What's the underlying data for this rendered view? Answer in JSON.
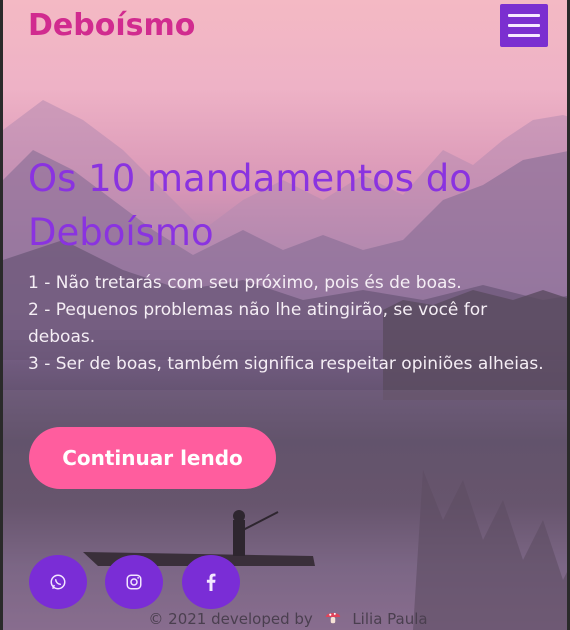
{
  "header": {
    "brand": "Deboísmo",
    "menu_icon": "hamburger-menu-icon"
  },
  "hero": {
    "title": "Os 10 mandamentos do Deboísmo",
    "commands": [
      "1 - Não tretarás com seu próximo, pois és de boas.",
      "2 - Pequenos problemas não lhe atingirão, se você for deboas.",
      "3 - Ser de boas, também significa respeitar opiniões alheias."
    ],
    "cta_label": "Continuar lendo"
  },
  "social": {
    "items": [
      {
        "icon": "whatsapp-icon"
      },
      {
        "icon": "instagram-icon"
      },
      {
        "icon": "facebook-icon"
      }
    ]
  },
  "footer": {
    "prefix": "© 2021 developed by",
    "author": "Lilia Paula",
    "icon": "mushroom-icon"
  },
  "colors": {
    "brand": "#d12b8f",
    "accent_purple": "#7b2fd0",
    "title_purple": "#8a33e0",
    "cta_pink": "#ff5d9e"
  }
}
